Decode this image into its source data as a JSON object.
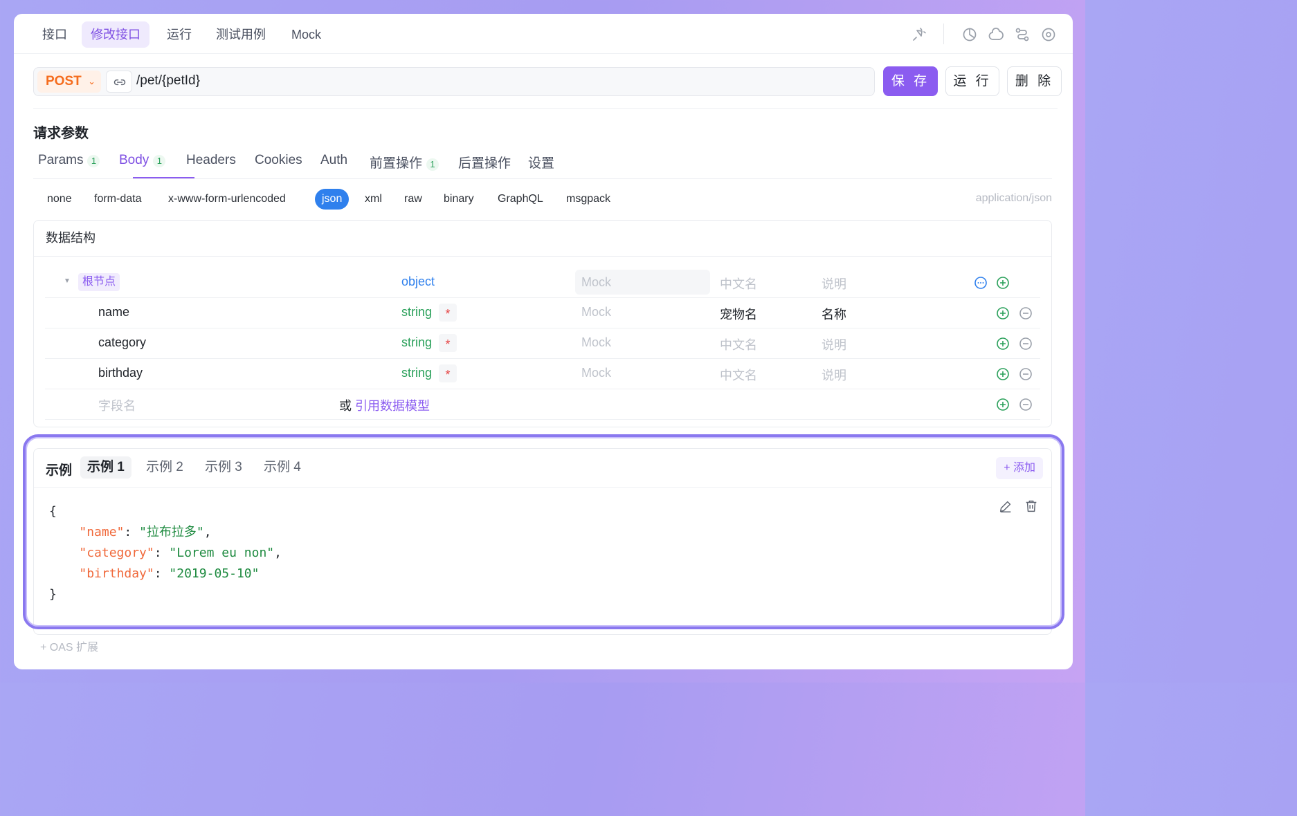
{
  "topnav": {
    "tabs": [
      "接口",
      "修改接口",
      "运行",
      "测试用例",
      "Mock"
    ],
    "active_index": 1,
    "icons": [
      "sparkle-pin-icon",
      "history-icon",
      "copy-icon",
      "share-flow-icon",
      "settings-icon"
    ]
  },
  "request": {
    "method": "POST",
    "url": "/pet/{petId}",
    "buttons": {
      "save": "保 存",
      "run": "运 行",
      "delete": "删 除"
    }
  },
  "params": {
    "title": "请求参数",
    "tabs": [
      {
        "label": "Params",
        "badge": "1"
      },
      {
        "label": "Body",
        "badge": "1"
      },
      {
        "label": "Headers",
        "badge": ""
      },
      {
        "label": "Cookies",
        "badge": ""
      },
      {
        "label": "Auth",
        "badge": ""
      },
      {
        "label": "前置操作",
        "badge": "1"
      },
      {
        "label": "后置操作",
        "badge": ""
      },
      {
        "label": "设置",
        "badge": ""
      }
    ],
    "active_tab": "Body"
  },
  "body_types": {
    "options": [
      "none",
      "form-data",
      "x-www-form-urlencoded",
      "json",
      "xml",
      "raw",
      "binary",
      "GraphQL",
      "msgpack"
    ],
    "selected": "json",
    "content_type": "application/json"
  },
  "schema": {
    "title": "数据结构",
    "root": {
      "tag": "根节点",
      "type": "object",
      "mock": "Mock",
      "cn": "中文名",
      "desc": "说明"
    },
    "fields": [
      {
        "name": "name",
        "type": "string",
        "required": "*",
        "mock": "Mock",
        "cn": "宠物名",
        "desc": "名称"
      },
      {
        "name": "category",
        "type": "string",
        "required": "*",
        "mock": "Mock",
        "cn": "中文名",
        "desc": "说明"
      },
      {
        "name": "birthday",
        "type": "string",
        "required": "*",
        "mock": "Mock",
        "cn": "中文名",
        "desc": "说明"
      }
    ],
    "new_field": {
      "placeholder": "字段名",
      "or_text": "或",
      "ref_link": "引用数据模型"
    }
  },
  "examples": {
    "title": "示例",
    "tabs": [
      "示例 1",
      "示例 2",
      "示例 3",
      "示例 4"
    ],
    "active_index": 0,
    "add_label": "+ 添加",
    "json": {
      "open": "{",
      "lines": [
        {
          "key": "\"name\"",
          "value": "\"拉布拉多\"",
          "trail": ","
        },
        {
          "key": "\"category\"",
          "value": "\"Lorem eu non\"",
          "trail": ","
        },
        {
          "key": "\"birthday\"",
          "value": "\"2019-05-10\"",
          "trail": ""
        }
      ],
      "close": "}"
    }
  },
  "footer": {
    "oas": "+ OAS 扩展"
  },
  "colors": {
    "accent": "#8b5cf0",
    "method": "#f56c1d",
    "string_type": "#2aa05a",
    "object_type": "#2f80ed",
    "json_key": "#f0683a",
    "json_value": "#1d8a3f"
  }
}
